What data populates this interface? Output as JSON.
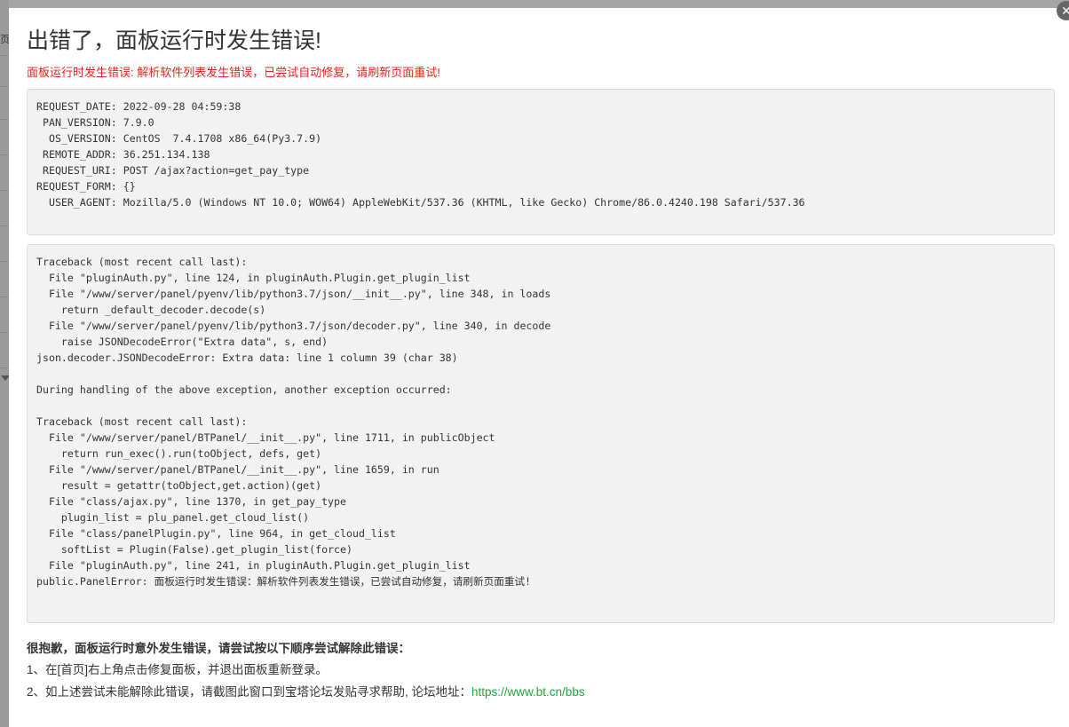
{
  "dialog": {
    "title": "出错了，面板运行时发生错误!",
    "subtitle": "面板运行时发生错误: 解析软件列表发生错误，已尝试自动修复，请刷新页面重试!",
    "close_icon": "close-icon"
  },
  "request_info": [
    "REQUEST_DATE: 2022-09-28 04:59:38",
    " PAN_VERSION: 7.9.0",
    "  OS_VERSION: CentOS  7.4.1708 x86_64(Py3.7.9)",
    " REMOTE_ADDR: 36.251.134.138",
    " REQUEST_URI: POST /ajax?action=get_pay_type",
    "REQUEST_FORM: {}",
    "  USER_AGENT: Mozilla/5.0 (Windows NT 10.0; WOW64) AppleWebKit/537.36 (KHTML, like Gecko) Chrome/86.0.4240.198 Safari/537.36"
  ],
  "traceback": [
    "Traceback (most recent call last):",
    "  File \"pluginAuth.py\", line 124, in pluginAuth.Plugin.get_plugin_list",
    "  File \"/www/server/panel/pyenv/lib/python3.7/json/__init__.py\", line 348, in loads",
    "    return _default_decoder.decode(s)",
    "  File \"/www/server/panel/pyenv/lib/python3.7/json/decoder.py\", line 340, in decode",
    "    raise JSONDecodeError(\"Extra data\", s, end)",
    "json.decoder.JSONDecodeError: Extra data: line 1 column 39 (char 38)",
    "",
    "During handling of the above exception, another exception occurred:",
    "",
    "Traceback (most recent call last):",
    "  File \"/www/server/panel/BTPanel/__init__.py\", line 1711, in publicObject",
    "    return run_exec().run(toObject, defs, get)",
    "  File \"/www/server/panel/BTPanel/__init__.py\", line 1659, in run",
    "    result = getattr(toObject,get.action)(get)",
    "  File \"class/ajax.py\", line 1370, in get_pay_type",
    "    plugin_list = plu_panel.get_cloud_list()",
    "  File \"class/panelPlugin.py\", line 964, in get_cloud_list",
    "    softList = Plugin(False).get_plugin_list(force)",
    "  File \"pluginAuth.py\", line 241, in pluginAuth.Plugin.get_plugin_list",
    "public.PanelError: 面板运行时发生错误：解析软件列表发生错误，已尝试自动修复，请刷新页面重试!"
  ],
  "help": {
    "title": "很抱歉，面板运行时意外发生错误，请尝试按以下顺序尝试解除此错误：",
    "step1": "1、在[首页]右上角点击修复面板，并退出面板重新登录。",
    "step2_prefix": "2、如上述尝试未能解除此错误，请截图此窗口到宝塔论坛发贴寻求帮助, 论坛地址：",
    "forum_link": "https://www.bt.cn/bbs"
  },
  "background": {
    "tab_fragment": "页"
  },
  "colors": {
    "error_red": "#e3241c",
    "link_green": "#20a53a",
    "code_bg": "#f2f2f2"
  }
}
